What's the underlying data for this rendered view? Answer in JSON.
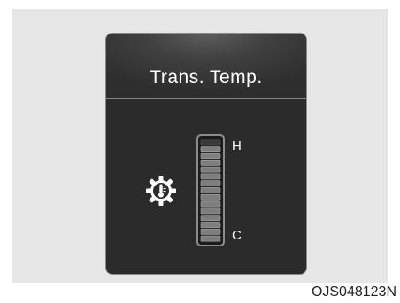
{
  "display": {
    "title": "Trans. Temp.",
    "gauge": {
      "high_label": "H",
      "low_label": "C",
      "segments_total": 15,
      "level_fraction": 0.93
    },
    "icon": "transmission-temperature-icon"
  },
  "figure_code": "OJS048123N",
  "colors": {
    "panel_background": "#2b2b2b",
    "frame_background": "#e6e6e6",
    "text": "#ffffff"
  }
}
